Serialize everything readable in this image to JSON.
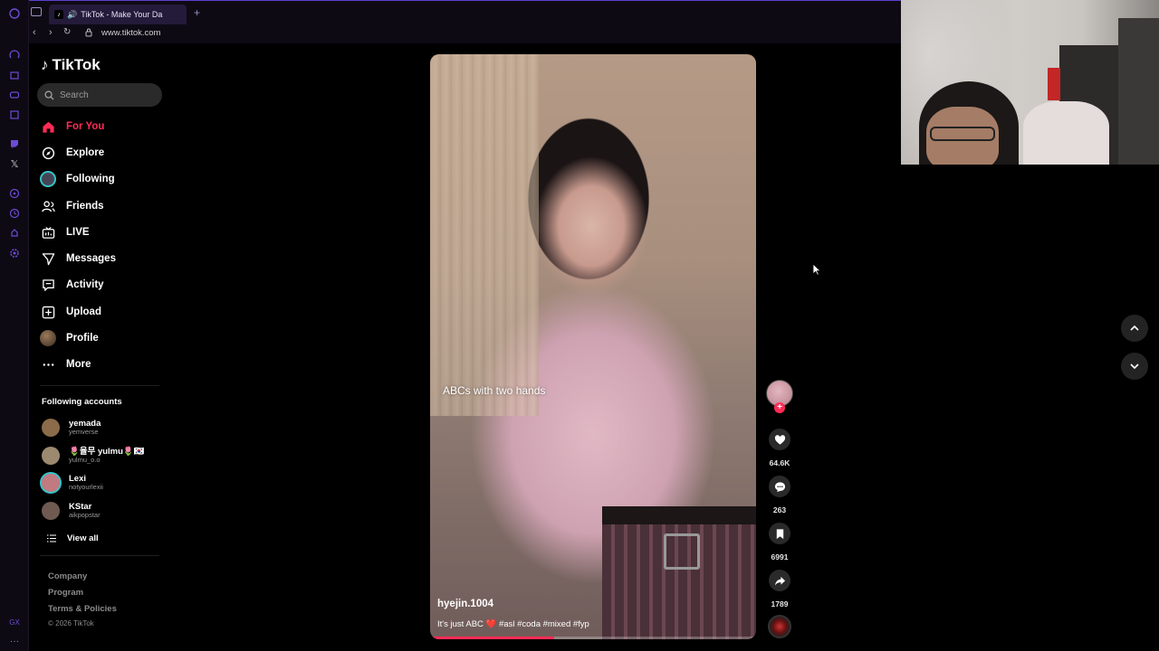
{
  "browser": {
    "tab_title": "TikTok - Make Your Da",
    "new_tab_label": "+",
    "url": "www.tiktok.com"
  },
  "sidebar": {
    "logo_text": "TikTok",
    "search_placeholder": "Search",
    "nav": [
      {
        "label": "For You",
        "icon": "home-icon",
        "active": true
      },
      {
        "label": "Explore",
        "icon": "compass-icon"
      },
      {
        "label": "Following",
        "icon": "following-avatar-icon"
      },
      {
        "label": "Friends",
        "icon": "friends-icon"
      },
      {
        "label": "LIVE",
        "icon": "live-icon"
      },
      {
        "label": "Messages",
        "icon": "messages-icon"
      },
      {
        "label": "Activity",
        "icon": "activity-icon"
      },
      {
        "label": "Upload",
        "icon": "upload-icon"
      },
      {
        "label": "Profile",
        "icon": "profile-avatar-icon"
      },
      {
        "label": "More",
        "icon": "more-icon"
      }
    ],
    "following_title": "Following accounts",
    "accounts": [
      {
        "name": "yemada",
        "handle": "yemverse",
        "color": "#8b6b4a"
      },
      {
        "name": "🌷율무 yulmu🌷🇰🇷",
        "handle": "yulmu_o.o",
        "color": "#9c8a70"
      },
      {
        "name": "Lexi",
        "handle": "notyourlexii",
        "color": "#c07a80"
      },
      {
        "name": "KStar",
        "handle": "aikpopstar",
        "color": "#6f5a52"
      }
    ],
    "view_all": "View all",
    "footer": {
      "company": "Company",
      "program": "Program",
      "terms": "Terms & Policies",
      "copyright": "© 2026 TikTok"
    }
  },
  "video": {
    "caption_overlay": "ABCs with two hands",
    "author": "hyejin.1004",
    "description": "It's just ABC ❤️ #asl #coda #mixed #fyp",
    "progress": 0.38
  },
  "actions": {
    "likes": "64.6K",
    "comments": "263",
    "saves": "6991",
    "shares": "1789"
  },
  "colors": {
    "accent": "#fe2c55",
    "browser_accent": "#6d4bd6"
  }
}
